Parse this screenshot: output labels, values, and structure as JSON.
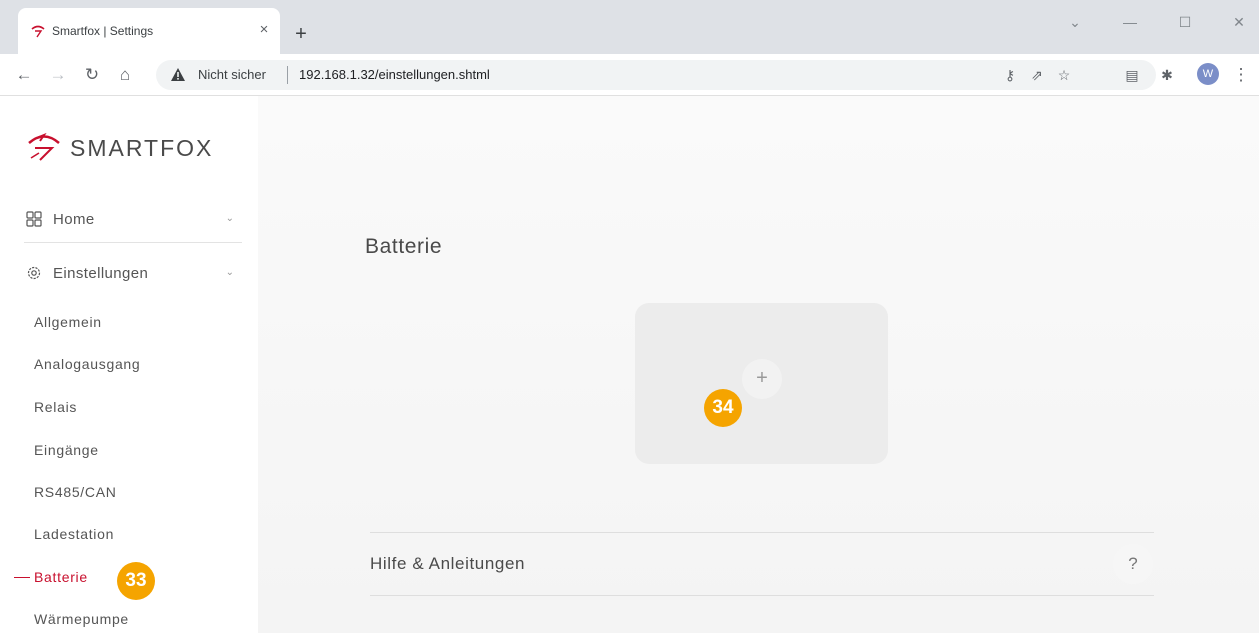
{
  "browser": {
    "tab_title": "Smartfox | Settings",
    "tab_close": "×",
    "new_tab": "+",
    "security_label": "Nicht sicher",
    "url": "192.168.1.32/einstellungen.shtml",
    "profile_initial": "W",
    "window_controls": [
      "⌄",
      "—",
      "☐",
      "✕"
    ]
  },
  "sidebar": {
    "logo_text": "SMARTFOX",
    "top_items": [
      {
        "label": "Home",
        "icon": "grid-icon"
      },
      {
        "label": "Einstellungen",
        "icon": "gear-icon"
      }
    ],
    "sub_items": [
      {
        "label": "Allgemein"
      },
      {
        "label": "Analogausgang"
      },
      {
        "label": "Relais"
      },
      {
        "label": "Eingänge"
      },
      {
        "label": "RS485/CAN"
      },
      {
        "label": "Ladestation"
      },
      {
        "label": "Batterie",
        "active": true
      },
      {
        "label": "Wärmepumpe"
      }
    ]
  },
  "main": {
    "title": "Batterie",
    "add_symbol": "+",
    "help_label": "Hilfe & Anleitungen",
    "help_symbol": "?"
  },
  "annotations": {
    "step_sidebar": "33",
    "step_add": "34"
  },
  "colors": {
    "accent_red": "#c8102e",
    "badge_orange": "#f5a400"
  }
}
